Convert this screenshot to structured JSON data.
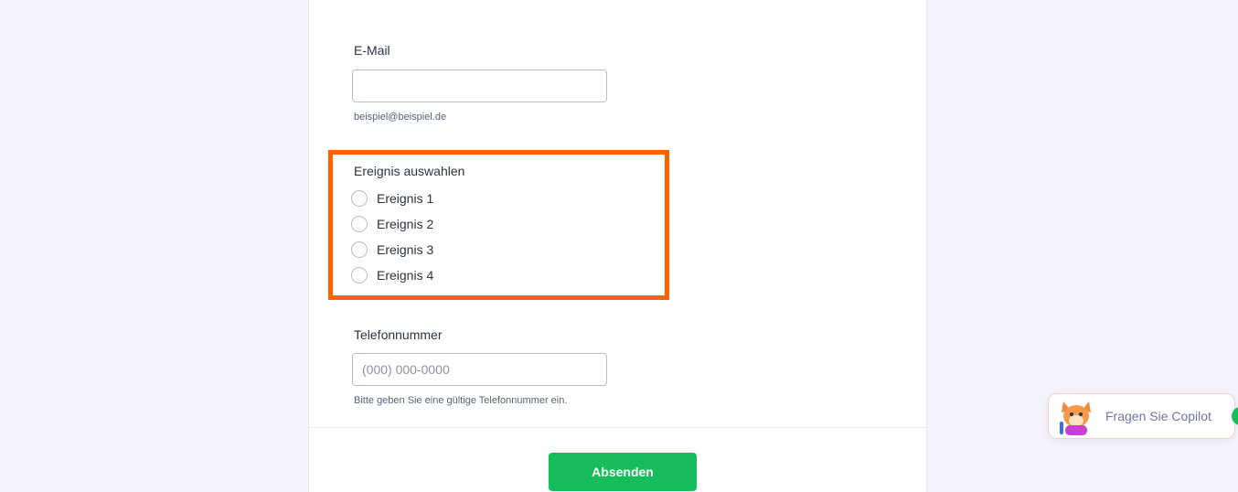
{
  "form": {
    "email": {
      "label": "E-Mail",
      "value": "",
      "placeholder": "",
      "sublabel": "beispiel@beispiel.de"
    },
    "event": {
      "label": "Ereignis auswahlen",
      "options": [
        {
          "label": "Ereignis 1",
          "checked": false
        },
        {
          "label": "Ereignis 2",
          "checked": false
        },
        {
          "label": "Ereignis 3",
          "checked": false
        },
        {
          "label": "Ereignis 4",
          "checked": false
        }
      ]
    },
    "phone": {
      "label": "Telefonnummer",
      "value": "",
      "placeholder": "(000) 000-0000",
      "sublabel": "Bitte geben Sie eine gültige Telefonnummer ein."
    },
    "submit_label": "Absenden"
  },
  "copilot": {
    "label": "Fragen Sie Copilot",
    "avatar_icon": "fox-mascot-icon"
  },
  "colors": {
    "highlight": "#ff6100",
    "submit": "#18bd5b",
    "background": "#f3f3fe"
  }
}
